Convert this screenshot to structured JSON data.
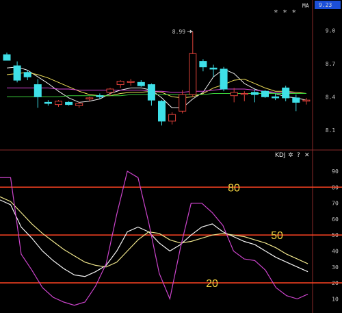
{
  "top_panel": {
    "ma_label": "MA",
    "price_badge": "9.23",
    "stars": "* * *",
    "peak_label": "8.99"
  },
  "kdj_panel": {
    "title": "KDJ",
    "icons": [
      "gear-icon",
      "help-icon",
      "close-icon"
    ],
    "help_glyph": "?",
    "close_glyph": "✕",
    "gear_glyph": "✲"
  },
  "colors": {
    "background": "#000000",
    "up_candle": "#e0413a",
    "down_candle": "#3fe0e8",
    "ma5": "#f0f0f0",
    "ma10": "#f1e05a",
    "ma20": "#d845d8",
    "ma60": "#3ad03a",
    "k_line": "#f4f4f4",
    "d_line": "#f0e68c",
    "j_line": "#cc44cc",
    "ref_line": "#ff4422",
    "annotation": "#f2d240",
    "badge_bg": "#1c4fd8"
  },
  "chart_data": [
    {
      "type": "candlestick",
      "title": "",
      "y_ticks": [
        "9.0",
        "8.7",
        "8.4",
        "8.1"
      ],
      "ylim": [
        7.95,
        9.25
      ],
      "annotations": [
        {
          "text": "8.99",
          "candle_index": 18
        }
      ],
      "candles": [
        {
          "o": 8.78,
          "h": 8.8,
          "l": 8.73,
          "c": 8.73
        },
        {
          "o": 8.68,
          "h": 8.72,
          "l": 8.53,
          "c": 8.55
        },
        {
          "o": 8.62,
          "h": 8.64,
          "l": 8.55,
          "c": 8.58
        },
        {
          "o": 8.51,
          "h": 8.56,
          "l": 8.3,
          "c": 8.4
        },
        {
          "o": 8.35,
          "h": 8.37,
          "l": 8.32,
          "c": 8.34
        },
        {
          "o": 8.33,
          "h": 8.37,
          "l": 8.31,
          "c": 8.36
        },
        {
          "o": 8.35,
          "h": 8.36,
          "l": 8.32,
          "c": 8.33
        },
        {
          "o": 8.32,
          "h": 8.35,
          "l": 8.3,
          "c": 8.34
        },
        {
          "o": 8.38,
          "h": 8.4,
          "l": 8.36,
          "c": 8.39
        },
        {
          "o": 8.41,
          "h": 8.43,
          "l": 8.38,
          "c": 8.4
        },
        {
          "o": 8.44,
          "h": 8.48,
          "l": 8.41,
          "c": 8.47
        },
        {
          "o": 8.51,
          "h": 8.55,
          "l": 8.48,
          "c": 8.54
        },
        {
          "o": 8.53,
          "h": 8.56,
          "l": 8.5,
          "c": 8.54
        },
        {
          "o": 8.53,
          "h": 8.55,
          "l": 8.49,
          "c": 8.5
        },
        {
          "o": 8.51,
          "h": 8.52,
          "l": 8.32,
          "c": 8.37
        },
        {
          "o": 8.36,
          "h": 8.37,
          "l": 8.14,
          "c": 8.18
        },
        {
          "o": 8.18,
          "h": 8.26,
          "l": 8.15,
          "c": 8.24
        },
        {
          "o": 8.27,
          "h": 8.46,
          "l": 8.25,
          "c": 8.42
        },
        {
          "o": 8.42,
          "h": 8.99,
          "l": 8.4,
          "c": 8.79
        },
        {
          "o": 8.72,
          "h": 8.74,
          "l": 8.63,
          "c": 8.67
        },
        {
          "o": 8.66,
          "h": 8.69,
          "l": 8.58,
          "c": 8.65
        },
        {
          "o": 8.65,
          "h": 8.67,
          "l": 8.45,
          "c": 8.47
        },
        {
          "o": 8.41,
          "h": 8.48,
          "l": 8.35,
          "c": 8.44
        },
        {
          "o": 8.42,
          "h": 8.45,
          "l": 8.36,
          "c": 8.43
        },
        {
          "o": 8.44,
          "h": 8.47,
          "l": 8.35,
          "c": 8.42
        },
        {
          "o": 8.45,
          "h": 8.46,
          "l": 8.39,
          "c": 8.4
        },
        {
          "o": 8.4,
          "h": 8.43,
          "l": 8.37,
          "c": 8.39
        },
        {
          "o": 8.48,
          "h": 8.5,
          "l": 8.36,
          "c": 8.39
        },
        {
          "o": 8.39,
          "h": 8.42,
          "l": 8.27,
          "c": 8.35
        },
        {
          "o": 8.37,
          "h": 8.39,
          "l": 8.33,
          "c": 8.37
        }
      ],
      "series": [
        {
          "key": "ma5",
          "values": [
            8.66,
            8.67,
            8.64,
            8.58,
            8.52,
            8.45,
            8.39,
            8.35,
            8.36,
            8.38,
            8.43,
            8.46,
            8.48,
            8.48,
            8.46,
            8.39,
            8.3,
            8.3,
            8.38,
            8.44,
            8.58,
            8.65,
            8.61,
            8.52,
            8.47,
            8.44,
            8.43,
            8.4,
            8.39,
            8.37
          ]
        },
        {
          "key": "ma10",
          "values": [
            8.6,
            8.61,
            8.62,
            8.6,
            8.57,
            8.53,
            8.49,
            8.45,
            8.42,
            8.41,
            8.41,
            8.43,
            8.44,
            8.44,
            8.45,
            8.44,
            8.4,
            8.39,
            8.4,
            8.43,
            8.48,
            8.51,
            8.55,
            8.56,
            8.52,
            8.48,
            8.45,
            8.45,
            8.44,
            8.43
          ]
        },
        {
          "key": "ma20",
          "values": [
            8.48,
            8.48,
            8.48,
            8.48,
            8.48,
            8.47,
            8.47,
            8.46,
            8.46,
            8.46,
            8.46,
            8.46,
            8.46,
            8.46,
            8.45,
            8.45,
            8.44,
            8.44,
            8.45,
            8.45,
            8.46,
            8.47,
            8.47,
            8.47,
            8.46,
            8.45,
            8.44,
            8.44,
            8.43,
            8.43
          ]
        },
        {
          "key": "ma60",
          "values": [
            8.4,
            8.4,
            8.4,
            8.4,
            8.4,
            8.4,
            8.41,
            8.41,
            8.41,
            8.41,
            8.41,
            8.41,
            8.42,
            8.42,
            8.42,
            8.42,
            8.42,
            8.42,
            8.42,
            8.42,
            8.43,
            8.43,
            8.43,
            8.43,
            8.43,
            8.43,
            8.43,
            8.43,
            8.43,
            8.43
          ]
        }
      ]
    },
    {
      "type": "line",
      "title": "KDJ",
      "y_ticks": [
        90,
        80,
        70,
        60,
        50,
        40,
        30,
        20,
        10
      ],
      "ylim": [
        5,
        96
      ],
      "reference_lines": [
        {
          "value": 80,
          "label": "80"
        },
        {
          "value": 50,
          "label": "50"
        },
        {
          "value": 20,
          "label": "20"
        }
      ],
      "series": [
        {
          "key": "k",
          "values": [
            72,
            69,
            55,
            48,
            40,
            34,
            29,
            25,
            24,
            27,
            31,
            40,
            52,
            55,
            52,
            45,
            40,
            44,
            50,
            55,
            57,
            52,
            49,
            46,
            44,
            40,
            36,
            33,
            30,
            27
          ]
        },
        {
          "key": "d",
          "values": [
            74,
            71,
            64,
            57,
            51,
            46,
            41,
            37,
            33,
            31,
            30,
            33,
            40,
            47,
            52,
            51,
            47,
            45,
            46,
            48,
            50,
            51,
            50,
            49,
            47,
            45,
            42,
            38,
            35,
            32
          ]
        },
        {
          "key": "j",
          "values": [
            86,
            86,
            38,
            28,
            17,
            11,
            8,
            6,
            8,
            18,
            32,
            63,
            90,
            86,
            58,
            26,
            10,
            42,
            70,
            70,
            64,
            56,
            40,
            35,
            34,
            28,
            17,
            12,
            10,
            13
          ]
        }
      ]
    }
  ]
}
